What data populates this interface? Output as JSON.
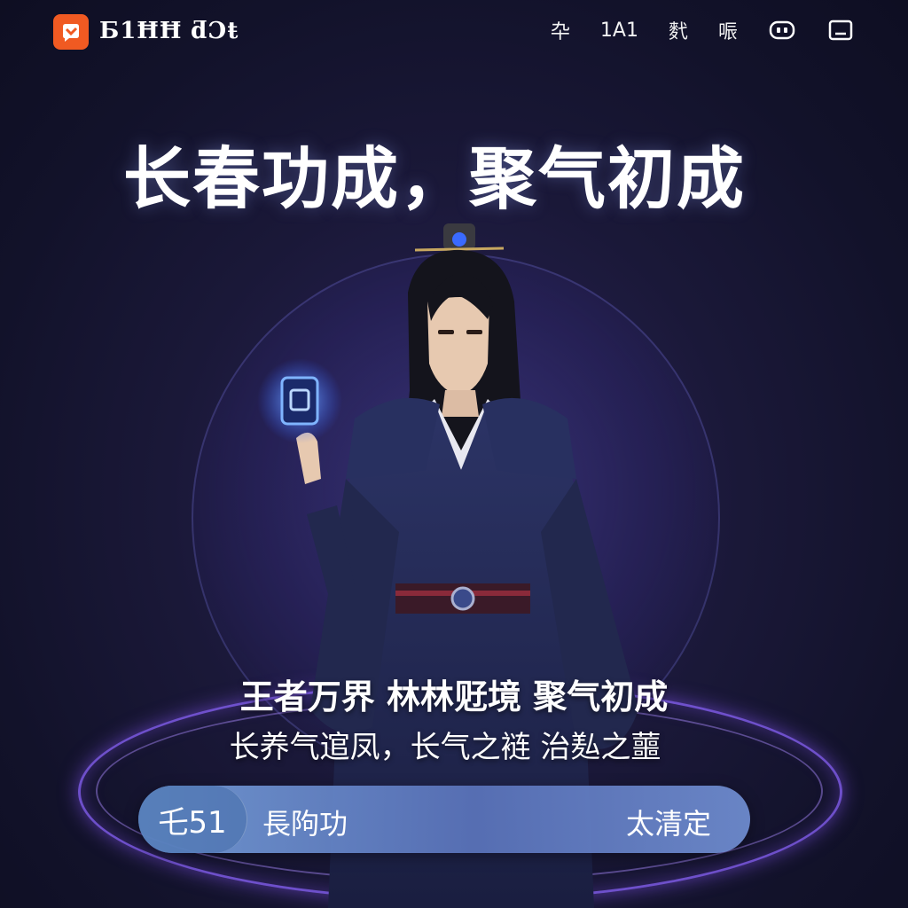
{
  "header": {
    "brand": "Ƃ1ĦĦ ƌƆŧ",
    "nav": [
      "卆",
      "1A1",
      "䴬",
      "㖘"
    ],
    "icons": [
      "gamepad-icon",
      "window-icon"
    ]
  },
  "hero": {
    "headline": "长春功成，聚气初成",
    "tagline": "王者万界 林林觃境 聚气初成",
    "subtitle": "长养气逭凤，长气之裢 治㕗之蘁"
  },
  "action_bar": {
    "level": "乇51",
    "skill": "長䧁功",
    "action": "太清定"
  },
  "colors": {
    "logo": "#f05a22",
    "background": "#16163a",
    "ring": "#8c64ff",
    "bar": "#6e8ed2"
  }
}
